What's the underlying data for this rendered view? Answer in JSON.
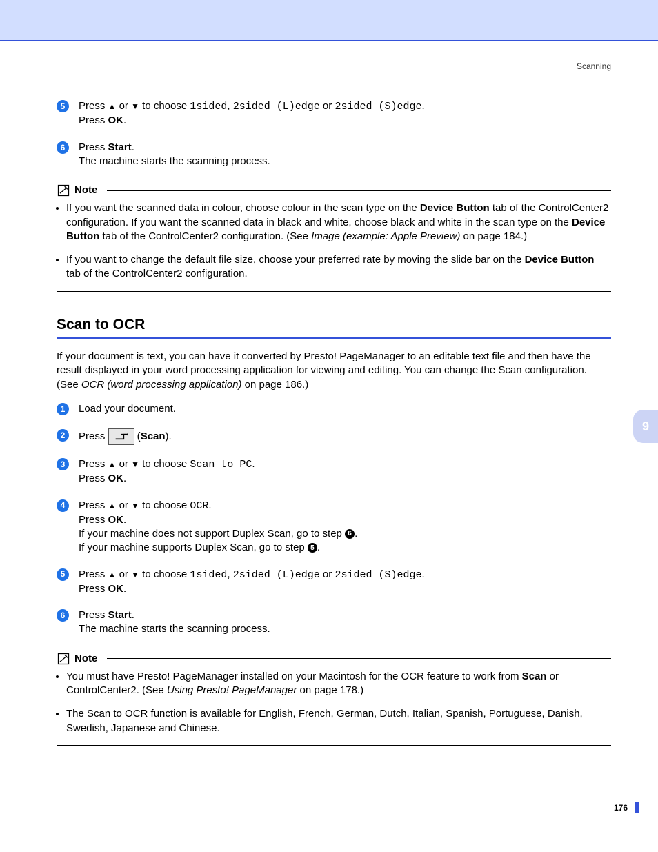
{
  "header": {
    "section": "Scanning"
  },
  "chapter": {
    "tab": "9",
    "page": "176"
  },
  "steps_a": {
    "s5": {
      "num": "5",
      "pre": "Press ",
      "mid": " to choose ",
      "opt1": "1sided",
      "c1": ", ",
      "opt2": "2sided (L)edge",
      "c2": " or ",
      "opt3": "2sided (S)edge",
      "end": ".",
      "l2a": "Press ",
      "l2b": "OK",
      "l2c": "."
    },
    "s6": {
      "num": "6",
      "l1a": "Press ",
      "l1b": "Start",
      "l1c": ".",
      "l2": "The machine starts the scanning process."
    }
  },
  "note1": {
    "label": "Note",
    "i1a": "If you want the scanned data in colour, choose colour in the scan type on the ",
    "i1b": "Device Button",
    "i1c": " tab of the ControlCenter2 configuration. If you want the scanned data in black and white, choose black and white in the scan type on the ",
    "i1d": "Device Button",
    "i1e": " tab of the ControlCenter2 configuration. (See ",
    "i1f": "Image (example: Apple Preview)",
    "i1g": " on page 184.)",
    "i2a": "If you want to change the default file size, choose your preferred rate by moving the slide bar on the ",
    "i2b": "Device Button",
    "i2c": " tab of the ControlCenter2 configuration."
  },
  "section": {
    "title": "Scan to OCR",
    "intro_a": "If your document is text, you can have it converted by Presto! PageManager to an editable text file and then have the result displayed in your word processing application for viewing and editing. You can change the Scan configuration. (See ",
    "intro_b": "OCR (word processing application)",
    "intro_c": " on page 186.)"
  },
  "steps_b": {
    "s1": {
      "num": "1",
      "text": "Load your document."
    },
    "s2": {
      "num": "2",
      "a": "Press ",
      "b": " (",
      "c": "Scan",
      "d": ")."
    },
    "s3": {
      "num": "3",
      "pre": "Press ",
      "mid": " to choose ",
      "opt": "Scan to PC",
      "end": ".",
      "l2a": "Press ",
      "l2b": "OK",
      "l2c": "."
    },
    "s4": {
      "num": "4",
      "pre": "Press ",
      "mid": " to choose ",
      "opt": "OCR",
      "end": ".",
      "l2a": "Press ",
      "l2b": "OK",
      "l2c": ".",
      "l3a": "If your machine does not support Duplex Scan, go to step ",
      "l3n": "6",
      "l3b": ".",
      "l4a": "If your machine supports Duplex Scan, go to step ",
      "l4n": "5",
      "l4b": "."
    },
    "s5": {
      "num": "5",
      "pre": "Press ",
      "mid": " to choose ",
      "opt1": "1sided",
      "c1": ", ",
      "opt2": "2sided (L)edge",
      "c2": " or ",
      "opt3": "2sided (S)edge",
      "end": ".",
      "l2a": "Press ",
      "l2b": "OK",
      "l2c": "."
    },
    "s6": {
      "num": "6",
      "l1a": "Press ",
      "l1b": "Start",
      "l1c": ".",
      "l2": "The machine starts the scanning process."
    }
  },
  "note2": {
    "label": "Note",
    "i1a": "You must have Presto! PageManager installed on your Macintosh for the OCR feature to work from ",
    "i1b": "Scan",
    "i1c": " or ControlCenter2. (See ",
    "i1d": "Using Presto! PageManager",
    "i1e": " on page 178.)",
    "i2": "The Scan to OCR function is available for English, French, German, Dutch, Italian, Spanish, Portuguese, Danish, Swedish, Japanese and Chinese."
  },
  "glyph": {
    "or": " or ",
    "up": "▲",
    "down": "▼"
  }
}
